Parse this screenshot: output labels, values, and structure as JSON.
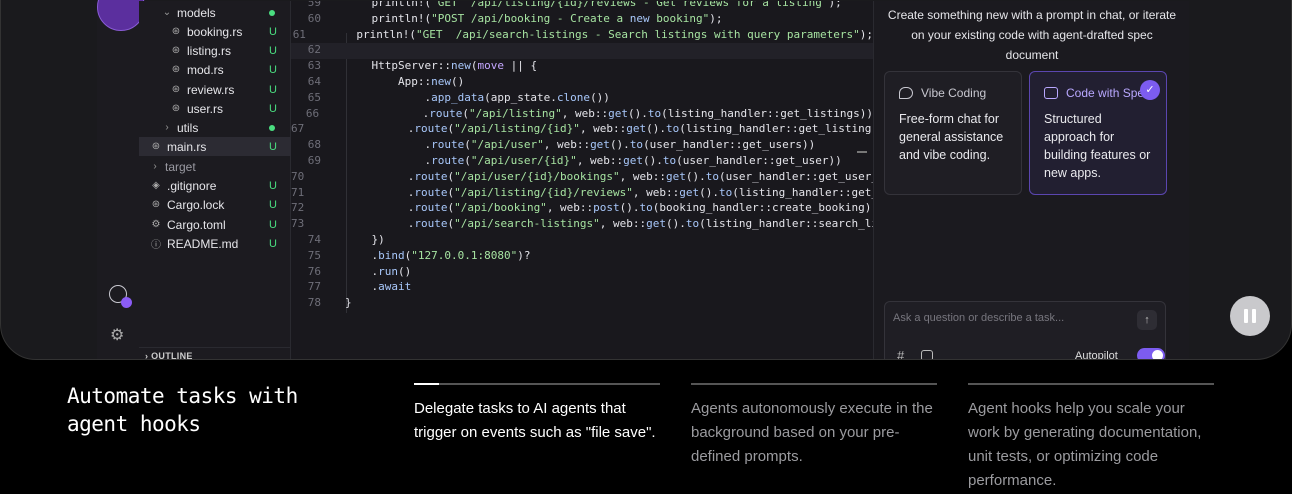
{
  "explorer": {
    "items": [
      {
        "label": "models",
        "kind": "folder-open",
        "status": "dot"
      },
      {
        "label": "booking.rs",
        "kind": "file",
        "status": "U"
      },
      {
        "label": "listing.rs",
        "kind": "file",
        "status": "U"
      },
      {
        "label": "mod.rs",
        "kind": "file",
        "status": "U"
      },
      {
        "label": "review.rs",
        "kind": "file",
        "status": "U"
      },
      {
        "label": "user.rs",
        "kind": "file",
        "status": "U"
      },
      {
        "label": "utils",
        "kind": "folder",
        "status": "dot"
      },
      {
        "label": "main.rs",
        "kind": "file",
        "status": "U"
      },
      {
        "label": "target",
        "kind": "folder",
        "status": ""
      },
      {
        "label": ".gitignore",
        "kind": "file",
        "status": "U"
      },
      {
        "label": "Cargo.lock",
        "kind": "file",
        "status": "U"
      },
      {
        "label": "Cargo.toml",
        "kind": "file",
        "status": "U"
      },
      {
        "label": "README.md",
        "kind": "file",
        "status": "U"
      }
    ],
    "outline_label": "OUTLINE"
  },
  "editor": {
    "lines": [
      {
        "n": "59",
        "text": "    println!(\"GET  /api/listing/{id}/reviews - Get reviews for a listing\");"
      },
      {
        "n": "60",
        "text": "    println!(\"POST /api/booking - Create a new booking\");"
      },
      {
        "n": "61",
        "text": "    println!(\"GET  /api/search-listings - Search listings with query parameters\");"
      },
      {
        "n": "62",
        "text": ""
      },
      {
        "n": "63",
        "text": "    HttpServer::new(move || {"
      },
      {
        "n": "64",
        "text": "        App::new()"
      },
      {
        "n": "65",
        "text": "            .app_data(app_state.clone())"
      },
      {
        "n": "66",
        "text": "            .route(\"/api/listing\", web::get().to(listing_handler::get_listings))"
      },
      {
        "n": "67",
        "text": "            .route(\"/api/listing/{id}\", web::get().to(listing_handler::get_listing))"
      },
      {
        "n": "68",
        "text": "            .route(\"/api/user\", web::get().to(user_handler::get_users))"
      },
      {
        "n": "69",
        "text": "            .route(\"/api/user/{id}\", web::get().to(user_handler::get_user))"
      },
      {
        "n": "70",
        "text": "            .route(\"/api/user/{id}/bookings\", web::get().to(user_handler::get_user_bookings))"
      },
      {
        "n": "71",
        "text": "            .route(\"/api/listing/{id}/reviews\", web::get().to(listing_handler::get_reviews))"
      },
      {
        "n": "72",
        "text": "            .route(\"/api/booking\", web::post().to(booking_handler::create_booking))"
      },
      {
        "n": "73",
        "text": "            .route(\"/api/search-listings\", web::get().to(listing_handler::search_listings))"
      },
      {
        "n": "74",
        "text": "    })"
      },
      {
        "n": "75",
        "text": "    .bind(\"127.0.0.1:8080\")?"
      },
      {
        "n": "76",
        "text": "    .run()"
      },
      {
        "n": "77",
        "text": "    .await"
      },
      {
        "n": "78",
        "text": "}"
      }
    ]
  },
  "chat": {
    "intro": "Create something new with a prompt in chat, or iterate on your existing code with agent-drafted spec document",
    "cards": [
      {
        "title": "Vibe Coding",
        "body": "Free-form chat for general assistance and vibe coding."
      },
      {
        "title": "Code with Spec",
        "body": "Structured approach for building features or new apps."
      }
    ],
    "input_placeholder": "Ask a question or describe a task...",
    "autopilot_label": "Autopilot"
  },
  "bottom": {
    "headline_line1": "Automate tasks with",
    "headline_line2": "agent hooks",
    "features": [
      {
        "text": "Delegate tasks to AI agents that trigger on events such as \"file save\".",
        "progress": 0.1
      },
      {
        "text": "Agents autonomously execute in the background based on your pre-defined prompts.",
        "progress": 0
      },
      {
        "text": "Agent hooks help you scale your work by generating documentation, unit tests, or optimizing code performance.",
        "progress": 0
      }
    ]
  },
  "colors": {
    "accent": "#7c5cf0",
    "status_green": "#4ade80"
  }
}
